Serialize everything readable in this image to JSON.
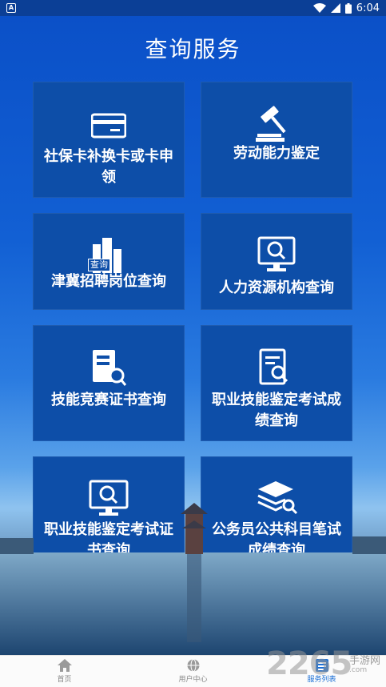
{
  "status_bar": {
    "notification": "A",
    "time": "6:04"
  },
  "page": {
    "title": "查询服务"
  },
  "cards": [
    {
      "label": "社保卡补换卡或卡申领",
      "icon": "card-icon"
    },
    {
      "label": "劳动能力鉴定",
      "icon": "gavel-icon"
    },
    {
      "label": "津冀招聘岗位查询",
      "icon": "buildings-search-icon",
      "badge": "查询"
    },
    {
      "label": "人力资源机构查询",
      "icon": "monitor-search-icon"
    },
    {
      "label": "技能竞赛证书查询",
      "icon": "document-search-icon"
    },
    {
      "label": "职业技能鉴定考试成绩查询",
      "icon": "report-search-icon"
    },
    {
      "label": "职业技能鉴定考试证书查询",
      "icon": "monitor-search-icon"
    },
    {
      "label": "公务员公共科目笔试成绩查询",
      "icon": "books-search-icon"
    }
  ],
  "bottom_nav": [
    {
      "label": "首页",
      "icon": "home-icon",
      "active": false
    },
    {
      "label": "用户中心",
      "icon": "user-globe-icon",
      "active": false
    },
    {
      "label": "服务列表",
      "icon": "list-icon",
      "active": true
    }
  ],
  "watermark": {
    "number": "2265",
    "text": "手游网",
    "url": ".com"
  },
  "colors": {
    "card_bg": "#0d4ea8",
    "status_bar_bg": "#0b3f96",
    "active_nav": "#1a6fd6"
  }
}
